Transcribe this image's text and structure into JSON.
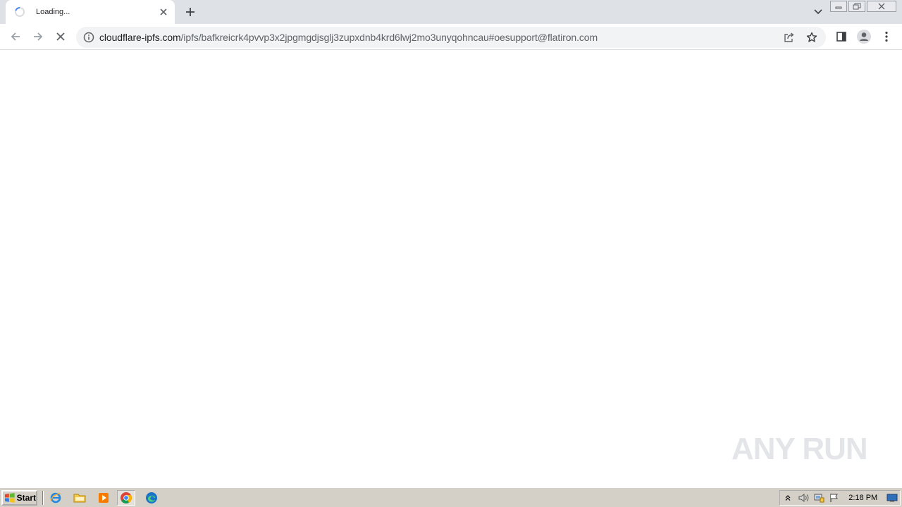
{
  "browser": {
    "tab": {
      "title": "Loading..."
    },
    "address": {
      "host": "cloudflare-ipfs.com",
      "path": "/ipfs/bafkreicrk4pvvp3x2jpgmgdjsglj3zupxdnb4krd6lwj2mo3unyqohncau#oesupport@flatiron.com"
    },
    "icons": {
      "back": "arrow-left-icon",
      "forward": "arrow-right-icon",
      "stop": "close-icon",
      "site_info": "info-circle-icon",
      "share": "share-icon",
      "bookmark": "star-icon",
      "side_panel": "side-panel-icon",
      "profile": "person-icon",
      "menu": "three-dots-vertical-icon"
    }
  },
  "watermark": {
    "text": "ANY RUN"
  },
  "taskbar": {
    "start_label": "Start",
    "clock": "2:18 PM",
    "quick_launch": [
      "internet-explorer-icon",
      "folder-icon",
      "media-player-icon",
      "chrome-icon",
      "edge-icon"
    ]
  }
}
